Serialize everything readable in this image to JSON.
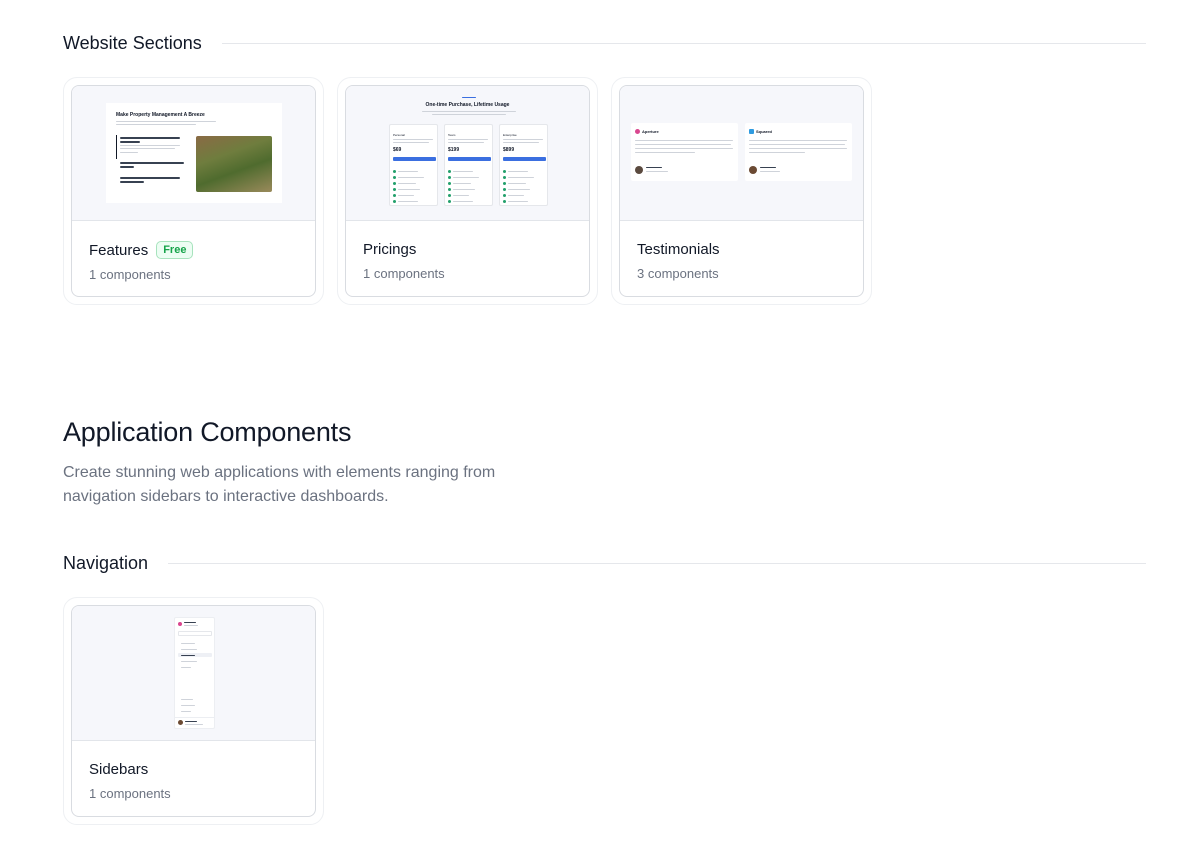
{
  "website_sections": {
    "heading": "Website Sections",
    "cards": [
      {
        "title": "Features",
        "badge": "Free",
        "count": "1 components",
        "preview": {
          "headline": "Make Property Management A Breeze"
        }
      },
      {
        "title": "Pricings",
        "badge": "",
        "count": "1 components",
        "preview": {
          "headline": "One-time Purchase, Lifetime Usage",
          "plans": [
            {
              "name": "Personal",
              "price": "$69"
            },
            {
              "name": "Team",
              "price": "$199"
            },
            {
              "name": "Enterprise",
              "price": "$899"
            }
          ]
        }
      },
      {
        "title": "Testimonials",
        "badge": "",
        "count": "3 components",
        "preview": {
          "brands": [
            "Aperture",
            "Squared"
          ]
        }
      }
    ]
  },
  "application_components": {
    "title": "Application Components",
    "description": "Create stunning web applications with elements ranging from navigation sidebars to interactive dashboards."
  },
  "navigation": {
    "heading": "Navigation",
    "cards": [
      {
        "title": "Sidebars",
        "badge": "",
        "count": "1 components"
      }
    ]
  },
  "colors": {
    "badge_green": "#16a34a",
    "accent_blue": "#3b6fe0"
  }
}
